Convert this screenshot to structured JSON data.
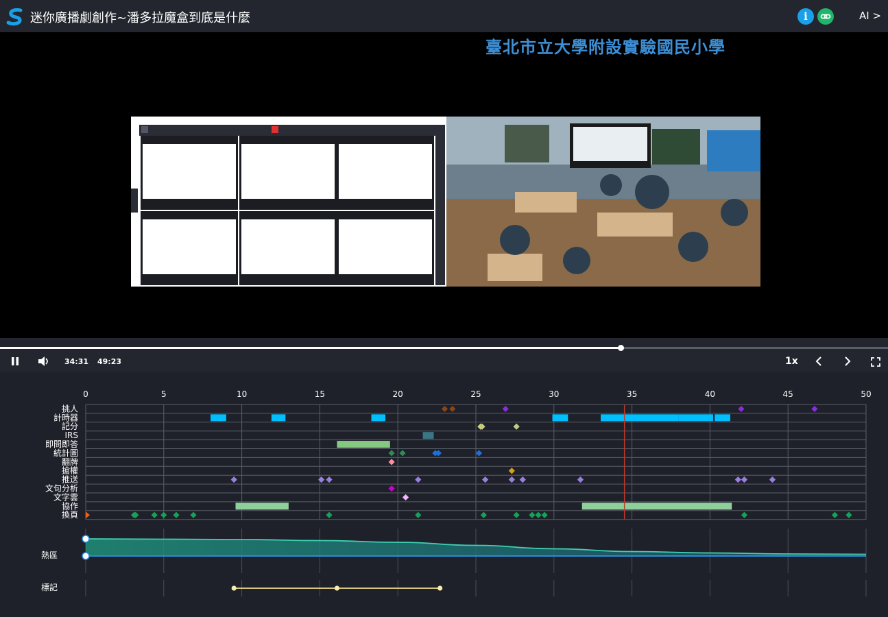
{
  "app": {
    "title": "迷你廣播劇創作~潘多拉魔盒到底是什麼",
    "ai_label": "AI >"
  },
  "video": {
    "school_name": "臺北市立大學附設實驗國民小學"
  },
  "player": {
    "current_time": "34:31",
    "total_time": "49:23",
    "speed": "1x",
    "progress": 0.699
  },
  "colors": {
    "timer": "#00bfff",
    "irs": "#3a7585",
    "green_bar": "#84c97f",
    "collab": "#8fd09a",
    "page_flip": "#18a058",
    "push": "#9b7fe0",
    "playhead": "#c0392b"
  },
  "timeline": {
    "x_ticks": [
      0,
      5,
      10,
      15,
      20,
      25,
      30,
      35,
      40,
      45,
      50
    ],
    "x_max": 50,
    "playhead": 34.52,
    "rows": [
      {
        "label": "挑人",
        "key": "pick"
      },
      {
        "label": "計時器",
        "key": "timer"
      },
      {
        "label": "記分",
        "key": "score"
      },
      {
        "label": "IRS",
        "key": "irs"
      },
      {
        "label": "即問即答",
        "key": "quiz"
      },
      {
        "label": "統計圖",
        "key": "stats"
      },
      {
        "label": "翻牌",
        "key": "flip"
      },
      {
        "label": "搶權",
        "key": "buzz"
      },
      {
        "label": "推送",
        "key": "push"
      },
      {
        "label": "文句分析",
        "key": "text_analysis"
      },
      {
        "label": "文字雲",
        "key": "wordcloud"
      },
      {
        "label": "協作",
        "key": "collab"
      },
      {
        "label": "換頁",
        "key": "page"
      }
    ],
    "events": {
      "pick": {
        "type": "diamond",
        "items": [
          {
            "t": 23.0,
            "c": "#8b4513"
          },
          {
            "t": 23.5,
            "c": "#8b4513"
          },
          {
            "t": 26.9,
            "c": "#8a2be2"
          },
          {
            "t": 42.0,
            "c": "#8a2be2"
          },
          {
            "t": 46.7,
            "c": "#8a2be2"
          }
        ]
      },
      "timer": {
        "type": "bar",
        "color": "#00bfff",
        "items": [
          [
            8.0,
            9.0
          ],
          [
            11.9,
            12.8
          ],
          [
            18.3,
            19.2
          ],
          [
            29.9,
            30.9
          ],
          [
            33.0,
            38.0
          ],
          [
            38.0,
            40.2
          ],
          [
            40.3,
            41.3
          ]
        ]
      },
      "score": {
        "type": "diamond",
        "items": [
          {
            "t": 25.3,
            "c": "#d4d96a"
          },
          {
            "t": 25.4,
            "c": "#c4c98a"
          },
          {
            "t": 27.6,
            "c": "#c4c98a"
          }
        ]
      },
      "irs": {
        "type": "bar",
        "color": "#3a7585",
        "items": [
          [
            21.6,
            22.3
          ]
        ]
      },
      "quiz": {
        "type": "bar",
        "color": "#84c97f",
        "items": [
          [
            16.1,
            19.5
          ]
        ]
      },
      "stats": {
        "type": "diamond",
        "items": [
          {
            "t": 19.6,
            "c": "#2e8b57"
          },
          {
            "t": 20.3,
            "c": "#2e8b57"
          },
          {
            "t": 22.4,
            "c": "#1e6fd9"
          },
          {
            "t": 22.6,
            "c": "#1e6fd9"
          },
          {
            "t": 25.2,
            "c": "#1e6fd9"
          }
        ]
      },
      "flip": {
        "type": "diamond",
        "items": [
          {
            "t": 19.6,
            "c": "#ff8ca0"
          }
        ]
      },
      "buzz": {
        "type": "diamond",
        "items": [
          {
            "t": 27.3,
            "c": "#d4a017"
          }
        ]
      },
      "push": {
        "type": "diamond",
        "items": [
          {
            "t": 9.5,
            "c": "#9b7fe0"
          },
          {
            "t": 15.1,
            "c": "#9b7fe0"
          },
          {
            "t": 15.6,
            "c": "#9b7fe0"
          },
          {
            "t": 21.3,
            "c": "#9b7fe0"
          },
          {
            "t": 25.6,
            "c": "#9b7fe0"
          },
          {
            "t": 27.3,
            "c": "#9b7fe0"
          },
          {
            "t": 28.0,
            "c": "#9b7fe0"
          },
          {
            "t": 31.7,
            "c": "#9b7fe0"
          },
          {
            "t": 41.8,
            "c": "#9b7fe0"
          },
          {
            "t": 42.2,
            "c": "#9b7fe0"
          },
          {
            "t": 44.0,
            "c": "#9b7fe0"
          }
        ]
      },
      "text_analysis": {
        "type": "diamond",
        "items": [
          {
            "t": 19.6,
            "c": "#cc00cc"
          }
        ]
      },
      "wordcloud": {
        "type": "diamond",
        "items": [
          {
            "t": 20.5,
            "c": "#f4b6ff"
          }
        ]
      },
      "collab": {
        "type": "bar",
        "color": "#8fd09a",
        "items": [
          [
            9.6,
            13.0
          ],
          [
            31.8,
            41.4
          ]
        ]
      },
      "page": {
        "type": "diamond",
        "items": [
          {
            "t": 3.1,
            "c": "#18a058"
          },
          {
            "t": 3.2,
            "c": "#18a058"
          },
          {
            "t": 4.4,
            "c": "#18a058"
          },
          {
            "t": 5.0,
            "c": "#18a058"
          },
          {
            "t": 5.8,
            "c": "#18a058"
          },
          {
            "t": 6.9,
            "c": "#18a058"
          },
          {
            "t": 15.6,
            "c": "#18a058"
          },
          {
            "t": 21.3,
            "c": "#18a058"
          },
          {
            "t": 25.5,
            "c": "#18a058"
          },
          {
            "t": 27.6,
            "c": "#18a058"
          },
          {
            "t": 28.6,
            "c": "#18a058"
          },
          {
            "t": 29.0,
            "c": "#18a058"
          },
          {
            "t": 29.4,
            "c": "#18a058"
          },
          {
            "t": 42.2,
            "c": "#18a058"
          },
          {
            "t": 48.0,
            "c": "#18a058"
          },
          {
            "t": 48.9,
            "c": "#18a058"
          }
        ]
      }
    },
    "heat_label": "熱區",
    "heat_curve": [
      [
        0,
        1.0
      ],
      [
        5,
        0.98
      ],
      [
        10,
        0.96
      ],
      [
        15,
        0.9
      ],
      [
        20,
        0.8
      ],
      [
        25,
        0.62
      ],
      [
        30,
        0.42
      ],
      [
        35,
        0.26
      ],
      [
        40,
        0.18
      ],
      [
        45,
        0.12
      ],
      [
        50,
        0.1
      ]
    ],
    "mark_label": "標記",
    "marks": [
      9.5,
      16.1,
      22.7
    ]
  }
}
